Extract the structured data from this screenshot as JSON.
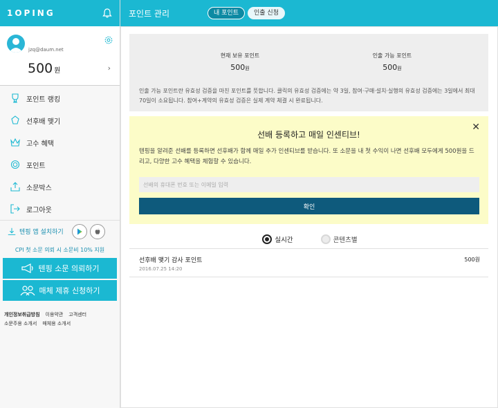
{
  "brand": {
    "logo": "1OPING",
    "accent": "#1bb8d2",
    "button_dark": "#0e5a7c"
  },
  "profile": {
    "email": "jzq@daum.net",
    "points_value": "500",
    "points_unit": "원"
  },
  "menu": [
    {
      "label": "포인트 랭킹",
      "icon": "trophy-icon"
    },
    {
      "label": "선후배 맺기",
      "icon": "people-icon"
    },
    {
      "label": "고수 혜택",
      "icon": "crown-icon"
    },
    {
      "label": "포인트",
      "icon": "coin-icon"
    },
    {
      "label": "소문박스",
      "icon": "upload-box-icon"
    },
    {
      "label": "로그아웃",
      "icon": "logout-icon"
    }
  ],
  "install": {
    "label": "텐핑 앱 설치하기"
  },
  "cpi_note": "CPI 첫 소문 의뢰 시 소문비 10% 지원",
  "cta": {
    "request": "텐핑 소문 의뢰하기",
    "partner": "매체 제휴 신청하기"
  },
  "footer": {
    "privacy": "개인정보취급방침",
    "terms": "이용약관",
    "support": "고객센터",
    "spreader_intro": "소문주용 소개서",
    "media_intro": "매체용 소개서"
  },
  "header": {
    "title": "포인트 관리",
    "tabs": [
      "내 포인트",
      "인출 신청"
    ]
  },
  "summary": {
    "current_label": "현재 보유 포인트",
    "current_value": "500",
    "current_unit": "원",
    "withdraw_label": "인출 가능 포인트",
    "withdraw_value": "500",
    "withdraw_unit": "원",
    "description": "인출 가능 포인트란 유효성 검증을 마친 포인트를 뜻합니다. 클릭의 유효성 검증에는 약 3일, 참여·구매·설치·실행의 유효성 검증에는 3일에서 최대 70일이 소요됩니다. 참여+계약의 유효성 검증은 실제 계약 체결 시 완료됩니다."
  },
  "banner": {
    "title": "선배 등록하고 매일 인센티브!",
    "description": "텐핑을 알려준 선배를 등록하면 선후배가 함께 매일 추가 인센티브를 받습니다. 또 소문을 내 첫 수익이 나면 선후배 모두에게 500원을 드리고, 다양한 고수 혜택을 체험할 수 있습니다.",
    "input_placeholder": "선배의 휴대폰 번호 또는 이메일 입력",
    "confirm_label": "확인"
  },
  "filters": {
    "realtime": "실시간",
    "by_content": "콘텐츠별"
  },
  "history": [
    {
      "title": "선후배 맺기 감사 포인트",
      "date": "2016.07.25 14:20",
      "amount": "500원"
    }
  ]
}
